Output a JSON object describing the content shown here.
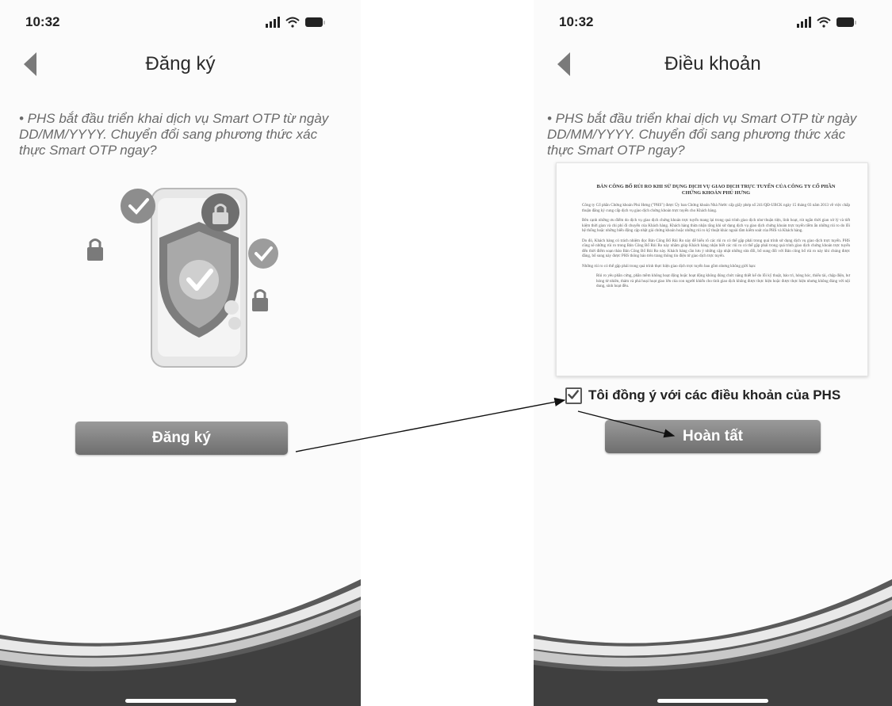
{
  "left_screen": {
    "status_time": "10:32",
    "title": "Đăng ký",
    "intro_lines": [
      "• PHS bắt đầu triển khai dịch vụ Smart OTP từ ngày",
      "DD/MM/YYYY. Chuyển đổi sang phương thức xác",
      "thực Smart OTP ngay?"
    ],
    "button_label": "Đăng ký"
  },
  "right_screen": {
    "status_time": "10:32",
    "title": "Điều khoản",
    "intro_lines": [
      "• PHS bắt đầu triển khai dịch vụ Smart OTP từ ngày",
      "DD/MM/YYYY. Chuyển đổi sang phương thức xác",
      "thực Smart OTP ngay?"
    ],
    "terms_document": {
      "title": "BẢN CÔNG BỐ RỦI RO KHI SỬ DỤNG DỊCH VỤ GIAO DỊCH TRỰC TUYẾN CỦA CÔNG TY CỔ PHẦN CHỨNG KHOÁN PHÚ HƯNG",
      "paragraphs": [
        "Công ty Cổ phần Chứng khoán Phú Hưng (\"PHS\") được Ủy ban Chứng khoán Nhà Nước cấp giấy phép số 241/QĐ-UBCK ngày 15 tháng 03 năm 2013 về việc chấp thuận đăng ký cung cấp dịch vụ giao dịch chứng khoán trực tuyến cho Khách hàng.",
        "Bên cạnh những ưu điểm do dịch vụ giao dịch chứng khoán trực tuyến mang lại trong quá trình giao dịch như thuận tiện, linh hoạt, rút ngắn thời gian xử lý và tiết kiệm thời gian và chi phí đi chuyển của Khách hàng. Khách hàng thừa nhận rằng khi sử dụng dịch vụ giao dịch chứng khoán trực tuyến tiềm ẩn những rủi ro do lỗi hệ thống hoặc những biến động cập nhật giá chứng khoán hoặc những rủi ro kỹ thuật khác ngoài tầm kiểm soát của PHS và Khách hàng.",
        "Do đó, Khách hàng có trách nhiệm đọc Bản Công Bố Rủi Ro này để hiểu rõ các rủi ro có thể gặp phải trong quá trình sử dụng dịch vụ giao dịch trực tuyến. PHS cũng sẽ những rủi ro trong Bản Công Bố Rủi Ro này nhằm giúp Khách hàng nhận biết các rủi ro có thể gặp phải trong quá trình giao dịch chứng khoán trực tuyến đến thời điểm soạn thảo Bản Công Bố Rủi Ro này. Khách hàng cần lưu ý những cập nhật những sửa đổi, bổ sung đối với Bản công bố rủi ro này khi chúng được đăng, bổ sung này được PHS thông báo trên trang thông tin điện tử giao dịch trực tuyến.",
        "Những rủi ro có thể gặp phải trong quá trình thực hiện giao dịch trực tuyến bao gồm nhưng không giới hạn:",
        "Rủi ro yêu phần cứng, phần mềm không hoạt động hoặc hoạt động không đúng chức năng thiết kế do lỗi kỹ thuật, bảo trì, hỏng hóc, thiếu tài, chập điện, hư hỏng từ nhiên, thảm và phá hoại hoạt giao lớn của con người khiến cho tình giao dịch không được thực hiện hoặc được thực hiện nhưng không đúng với nội dung, sinh hoạt đều."
      ]
    },
    "agree_label": "Tôi đồng ý với các điều khoản của PHS",
    "agree_checked": true,
    "button_label": "Hoàn tất"
  },
  "colors": {
    "button_top": "#9a9a9a",
    "button_bottom": "#6e6e6e",
    "intro_text": "#6a6a6a",
    "title_text": "#2a2a2a"
  }
}
